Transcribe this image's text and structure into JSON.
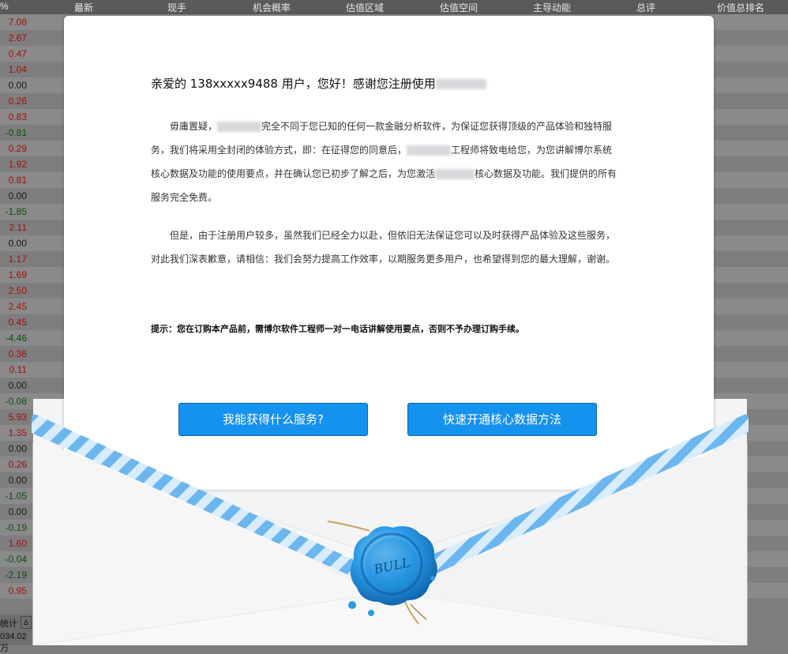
{
  "table": {
    "columns": [
      "%",
      "最新",
      "现手",
      "机会概率",
      "估值区域",
      "估值空间",
      "主导动能",
      "总评",
      "价值总排名"
    ],
    "pct_values": [
      "7.08",
      "2.67",
      "0.47",
      "1.04",
      "0.00",
      "0.26",
      "0.83",
      "-0.81",
      "0.29",
      "1.92",
      "0.81",
      "0.00",
      "-1.85",
      "2.11",
      "0.00",
      "1.17",
      "1.69",
      "2.50",
      "2.45",
      "0.45",
      "-4.46",
      "0.36",
      "0.11",
      "0.00",
      "-0.08",
      "5.93",
      "1.35",
      "0.00",
      "0.26",
      "0.00",
      "-1.05",
      "0.00",
      "-0.19",
      "1.60",
      "-0.04",
      "-2.19",
      "0.95"
    ],
    "footer_label": "统计",
    "footer_icon": "Δ",
    "footer_value": "034.02万"
  },
  "letter": {
    "greeting": "亲爱的 138xxxxx9488 用户，您好！感谢您注册使用",
    "p1_a": "毋庸置疑，",
    "p1_b": "完全不同于您已知的任何一款金融分析软件，为保证您获得顶级的产品体验和独特服务，我们将采用全封闭的体验方式，即：在征得您的同意后，",
    "p1_c": "工程师将致电给您，为您讲解博尔系统核心数据及功能的使用要点，并在确认您已初步了解之后，为您激活",
    "p1_d": "核心数据及功能。我们提供的所有服务完全免费。",
    "p2": "但是，由于注册用户较多，虽然我们已经全力以赴，但依旧无法保证您可以及时获得产品体验及这些服务，对此我们深表歉意，请相信：我们会努力提高工作效率，以期服务更多用户，也希望得到您的最大理解，谢谢。",
    "tip": "提示：您在订购本产品前，需博尔软件工程师一对一电话讲解使用要点，否则不予办理订购手续。"
  },
  "buttons": {
    "services": "我能获得什么服务?",
    "quick_open": "快速开通核心数据方法"
  },
  "seal": {
    "text": "BULL",
    "color": "#1f8fd8"
  },
  "colors": {
    "button": "#1591ee",
    "stripe_blue": "#6cb6ef",
    "positive": "#a01010",
    "negative": "#0d4d0d"
  }
}
